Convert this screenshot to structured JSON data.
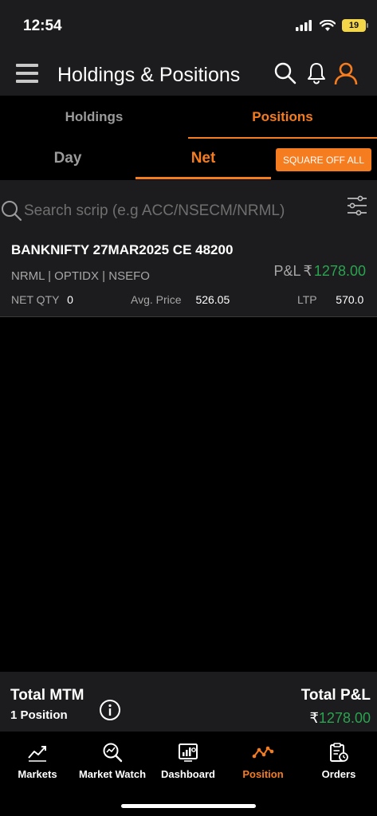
{
  "status_bar": {
    "time": "12:54",
    "battery": "19"
  },
  "header": {
    "title": "Holdings & Positions"
  },
  "primary_tabs": [
    {
      "label": "Holdings",
      "active": false
    },
    {
      "label": "Positions",
      "active": true
    }
  ],
  "sub_tabs": [
    {
      "label": "Day",
      "active": false
    },
    {
      "label": "Net",
      "active": true
    }
  ],
  "square_off_button": "SQUARE OFF ALL",
  "search": {
    "placeholder": "Search scrip (e.g ACC/NSECM/NRML)"
  },
  "positions": [
    {
      "symbol": "BANKNIFTY 27MAR2025 CE 48200",
      "meta": "NRML | OPTIDX |  NSEFO",
      "pl_label": "P&L",
      "currency": "₹",
      "pl_value": "1278.00",
      "net_qty_label": "NET QTY",
      "net_qty": "0",
      "avg_price_label": "Avg. Price",
      "avg_price": "526.05",
      "ltp_label": "LTP",
      "ltp": "570.0"
    }
  ],
  "summary": {
    "total_mtm_label": "Total MTM",
    "position_count": "1 Position",
    "total_pl_label": "Total P&L",
    "currency": "₹",
    "total_pl_value": "1278.00"
  },
  "bottom_nav": [
    {
      "label": "Markets",
      "icon": "trend-icon",
      "active": false
    },
    {
      "label": "Market Watch",
      "icon": "market-watch-icon",
      "active": false
    },
    {
      "label": "Dashboard",
      "icon": "dashboard-icon",
      "active": false
    },
    {
      "label": "Position",
      "icon": "position-icon",
      "active": true
    },
    {
      "label": "Orders",
      "icon": "orders-icon",
      "active": false
    }
  ],
  "colors": {
    "accent": "#f57c1f",
    "profit": "#2aa44f",
    "surface": "#1c1c1e",
    "background": "#000000"
  }
}
